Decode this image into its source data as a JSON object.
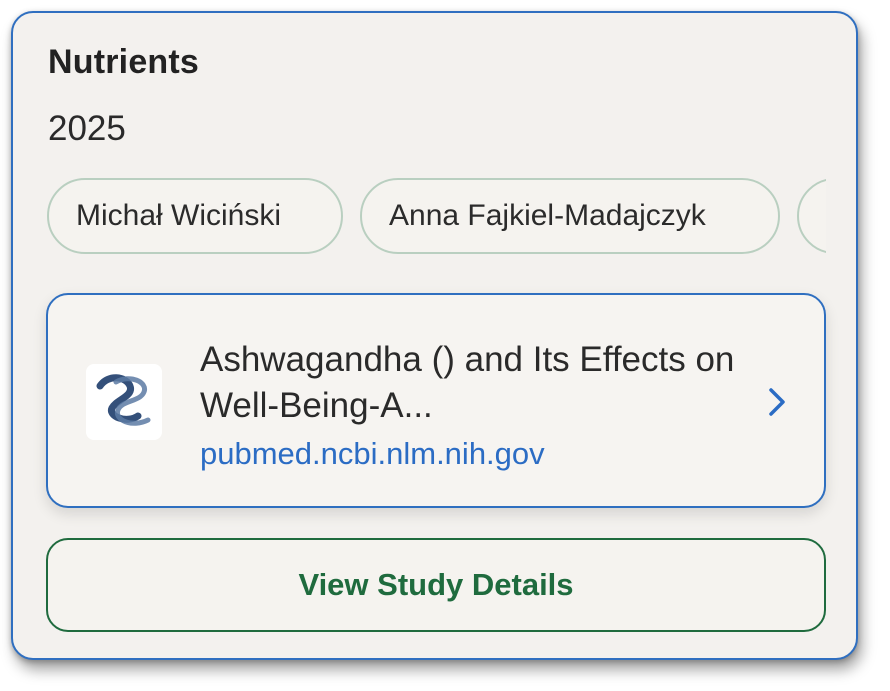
{
  "source": {
    "title": "Nutrients",
    "year": "2025"
  },
  "authors": [
    {
      "name": "Michał Wiciński"
    },
    {
      "name": "Anna Fajkiel-Madajczyk"
    },
    {
      "name": ""
    }
  ],
  "link_card": {
    "title": "Ashwagandha () and Its Effects on Well-Being-A...",
    "domain": "pubmed.ncbi.nlm.nih.gov",
    "icon": "pubmed-logo-icon",
    "chevron_icon": "chevron-right-icon"
  },
  "actions": {
    "view_details_label": "View Study Details"
  },
  "colors": {
    "accent_blue": "#2f6fc0",
    "link_blue": "#2b6cc4",
    "button_green": "#1f6b3e",
    "chip_border": "#b9cfc0",
    "card_background": "#f3f1ee"
  }
}
